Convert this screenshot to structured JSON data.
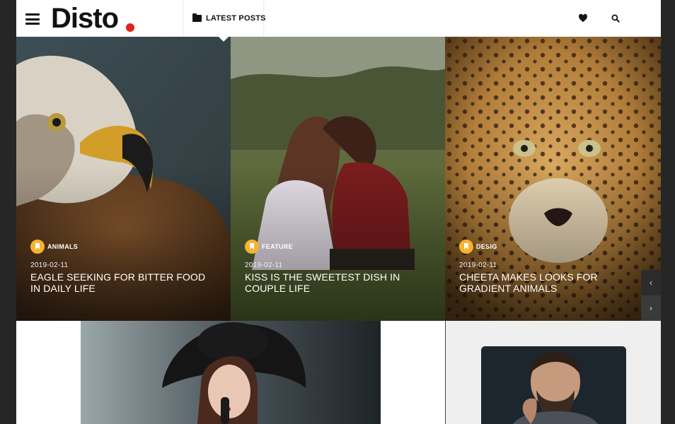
{
  "header": {
    "logo": "Disto",
    "nav_tab_label": "LATEST POSTS",
    "icons": {
      "menu": "hamburger-icon",
      "folder": "folder-icon",
      "wishlist": "heart-icon",
      "search": "search-icon"
    },
    "accent_color": "#e3211f"
  },
  "hero": {
    "cards": [
      {
        "category": "ANIMALS",
        "date": "2019-02-11",
        "title": "EAGLE SEEKING FOR BITTER FOOD IN DAILY LIFE"
      },
      {
        "category": "FEATURE",
        "date": "2019-02-11",
        "title": "KISS IS THE SWEETEST DISH IN COUPLE LIFE"
      },
      {
        "category": "DESIG",
        "date": "2019-02-11",
        "title": "CHEETA MAKES LOOKS FOR GRADIENT ANIMALS"
      }
    ],
    "category_badge_color": "#f7b230",
    "prev_label": "‹",
    "next_label": "›"
  }
}
